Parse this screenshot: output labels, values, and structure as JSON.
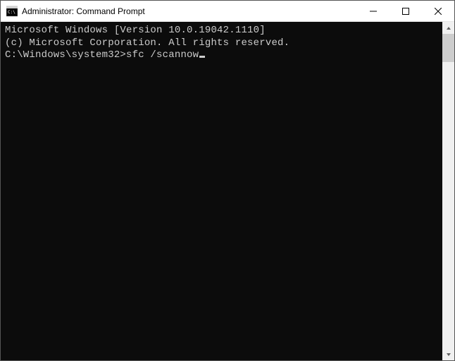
{
  "window": {
    "title": "Administrator: Command Prompt",
    "icon": "cmd-icon"
  },
  "terminal": {
    "line1": "Microsoft Windows [Version 10.0.19042.1110]",
    "line2": "(c) Microsoft Corporation. All rights reserved.",
    "blank": "",
    "prompt": "C:\\Windows\\system32>",
    "command": "sfc /scannow"
  }
}
